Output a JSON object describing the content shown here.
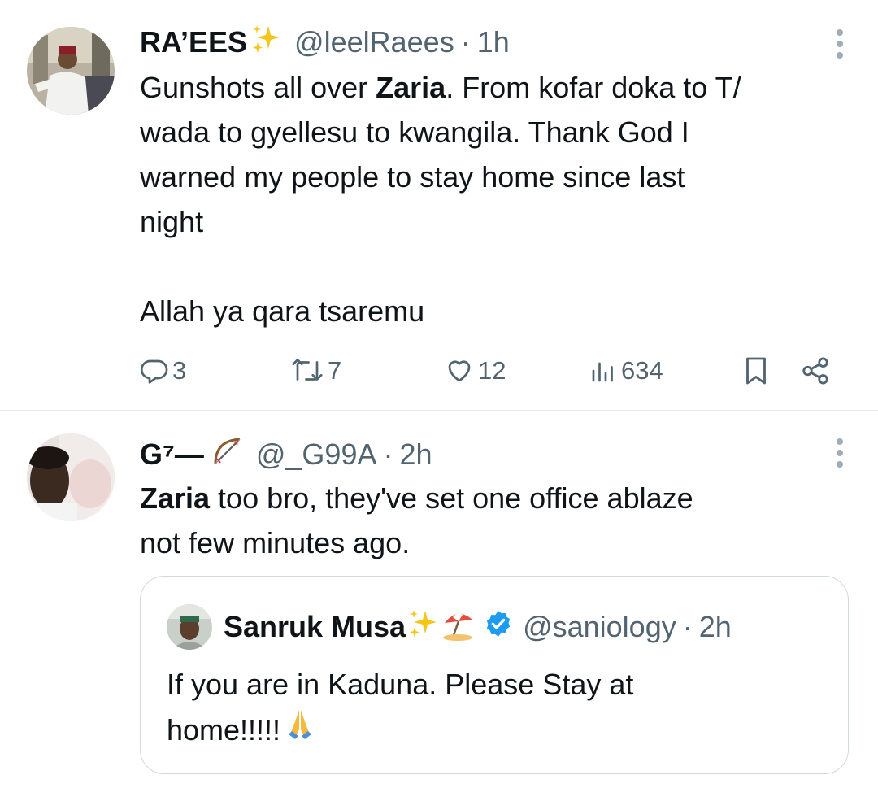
{
  "tweets": [
    {
      "author_name": "RA’EES",
      "author_emoji": "sparkles",
      "handle": "@leelRaees",
      "separator": "·",
      "time": "1h",
      "text_lines": [
        {
          "pre": "Gunshots all over ",
          "bold": "Zaria",
          "post": ". From kofar doka to T/"
        },
        {
          "pre": "wada to gyellesu to kwangila. Thank God I",
          "bold": "",
          "post": ""
        },
        {
          "pre": "warned my people to stay home since last",
          "bold": "",
          "post": ""
        },
        {
          "pre": "night",
          "bold": "",
          "post": ""
        },
        {
          "pre": "",
          "bold": "",
          "post": ""
        },
        {
          "pre": "Allah ya qara tsaremu",
          "bold": "",
          "post": ""
        }
      ],
      "actions": {
        "replies": "3",
        "reposts": "7",
        "likes": "12",
        "views": "634"
      }
    },
    {
      "author_name": "G⁷—",
      "author_emoji": "bow-and-arrow",
      "handle": "@_G99A",
      "separator": "·",
      "time": "2h",
      "text_lines": [
        {
          "pre": "",
          "bold": "Zaria",
          "post": " too bro, they've set one office ablaze"
        },
        {
          "pre": "not few minutes ago.",
          "bold": "",
          "post": ""
        }
      ],
      "quote": {
        "author_name": "Sanruk Musa",
        "author_emojis": [
          "sparkles",
          "beach-umbrella"
        ],
        "verified": true,
        "handle": "@saniology",
        "separator": "·",
        "time": "2h",
        "text_lines": [
          "If you are in Kaduna. Please Stay at",
          "home!!!!!"
        ],
        "trailing_emoji": "folded-hands"
      }
    }
  ],
  "colors": {
    "text": "#0f1419",
    "secondary": "#536471",
    "verified": "#1d9bf0",
    "divider": "#e6e9ec",
    "quote_border": "#cfd9de"
  }
}
